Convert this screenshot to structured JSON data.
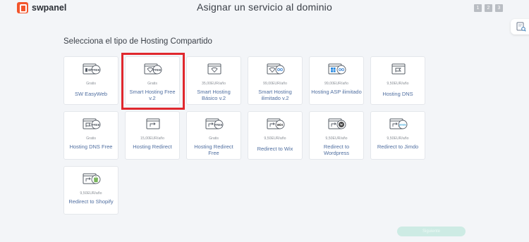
{
  "app": {
    "name": "swpanel"
  },
  "header": {
    "title": "Asignar un servicio al dominio",
    "steps": [
      "1",
      "2",
      "3"
    ]
  },
  "section": {
    "title": "Selecciona el tipo de Hosting Compartido"
  },
  "cards": [
    {
      "price": "Gratis",
      "name": "SW EasyWeb",
      "icon": "sw-free-icon"
    },
    {
      "price": "Gratis",
      "name": "Smart Hosting Free v.2",
      "icon": "diamond-free-icon",
      "selected": true
    },
    {
      "price": "35,00EUR/año",
      "name": "Smart Hosting Básico v.2",
      "icon": "diamond-icon"
    },
    {
      "price": "99,00EUR/año",
      "name": "Smart Hosting ilimitado v.2",
      "icon": "infinity-icon"
    },
    {
      "price": "99,00EUR/año",
      "name": "Hosting ASP ilimitado",
      "icon": "windows-infinity-icon"
    },
    {
      "price": "9,50EUR/año",
      "name": "Hosting DNS",
      "icon": "dns-icon"
    },
    {
      "price": "Gratis",
      "name": "Hosting DNS Free",
      "icon": "dns-free-icon"
    },
    {
      "price": "15,00EUR/año",
      "name": "Hosting Redirect",
      "icon": "redirect-icon"
    },
    {
      "price": "Gratis",
      "name": "Hosting Redirect Free",
      "icon": "redirect-free-icon"
    },
    {
      "price": "9,50EUR/año",
      "name": "Redirect to Wix",
      "icon": "wix-icon"
    },
    {
      "price": "9,50EUR/año",
      "name": "Redirect to Wordpress",
      "icon": "wordpress-icon"
    },
    {
      "price": "9,50EUR/año",
      "name": "Redirect to Jimdo",
      "icon": "jimdo-icon"
    },
    {
      "price": "9,50EUR/año",
      "name": "Redirect to Shopify",
      "icon": "shopify-icon"
    }
  ],
  "footer": {
    "next_label": "Siguiente"
  },
  "colors": {
    "brand": "#f2552c",
    "link": "#4f6ea0",
    "highlight": "#e0282e",
    "button": "#cdebe4"
  }
}
